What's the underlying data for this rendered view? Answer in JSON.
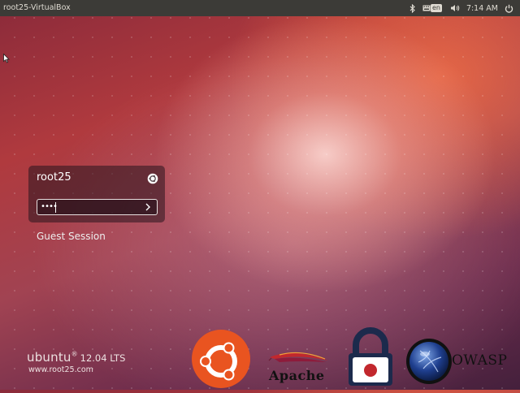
{
  "topbar": {
    "hostname": "root25-VirtualBox",
    "keyboard_layout": "en",
    "time": "7:14 AM",
    "icons": [
      "bluetooth-icon",
      "keyboard-icon",
      "volume-icon",
      "power-icon"
    ]
  },
  "greeter": {
    "username": "root25",
    "session_icon": "ubuntu-session-icon",
    "password_value": "••••",
    "submit_icon": "chevron-right-icon",
    "guest_label": "Guest Session"
  },
  "branding": {
    "os_name": "ubuntu",
    "registered_mark": "®",
    "version": "12.04 LTS",
    "website": "www.root25.com"
  },
  "logos": {
    "apache_label": "Apache",
    "owasp_label": "OWASP"
  },
  "colors": {
    "topbar_bg": "#3c3b37",
    "ubuntu_orange": "#e95420",
    "apache_red": "#c2282d",
    "lock_navy": "#1c2a4c",
    "owasp_blue": "#1f3f8f"
  }
}
